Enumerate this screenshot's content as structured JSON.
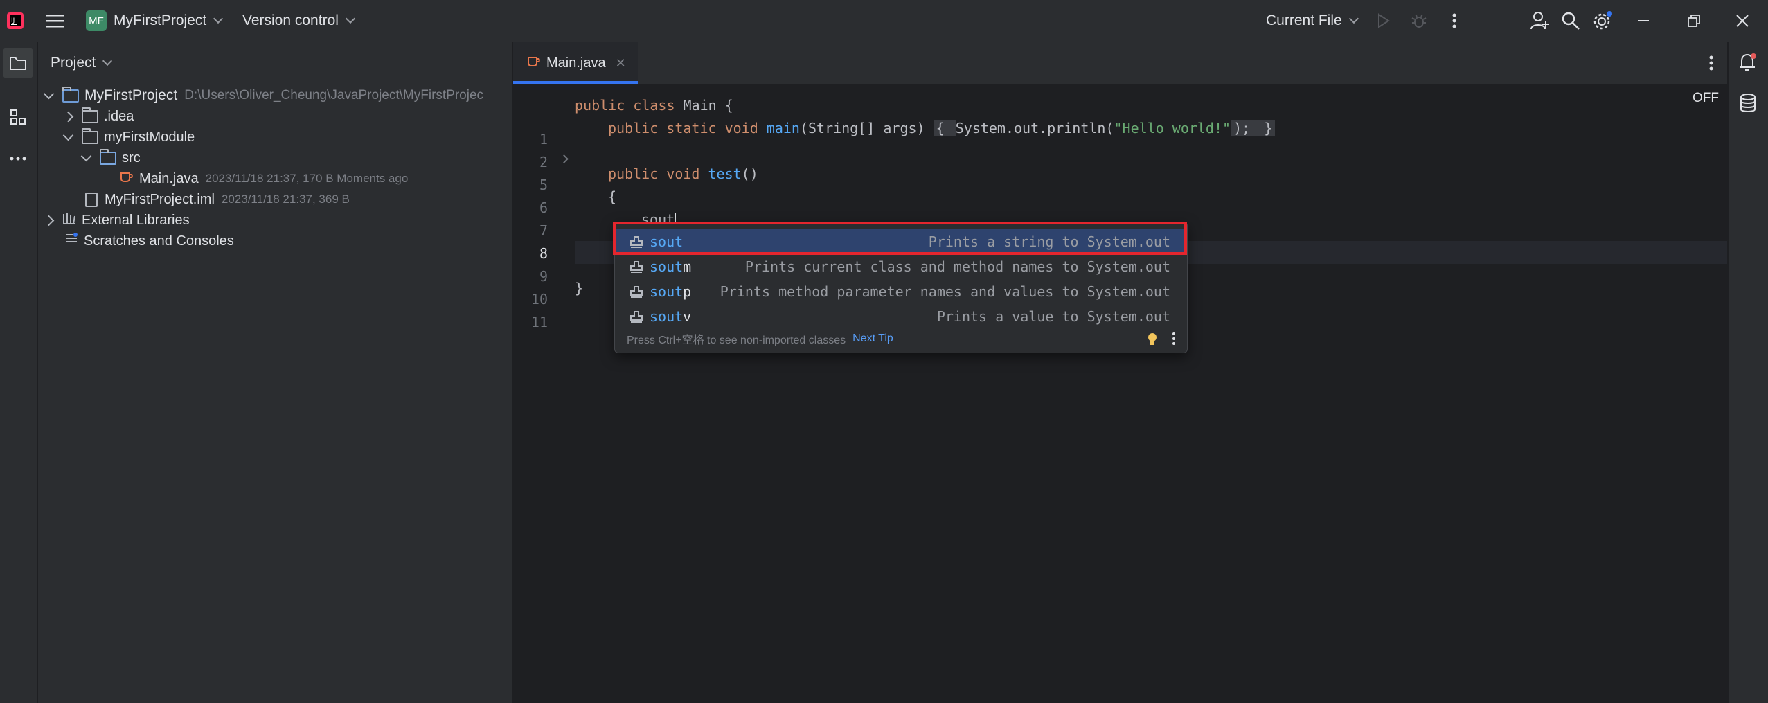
{
  "titlebar": {
    "project_badge": "MF",
    "project_name": "MyFirstProject",
    "vcs": "Version control",
    "run_config": "Current File"
  },
  "project_panel": {
    "title": "Project",
    "tree": [
      {
        "label": "MyFirstProject",
        "meta": "D:\\Users\\Oliver_Cheung\\JavaProject\\MyFirstProjec"
      },
      {
        "label": ".idea",
        "meta": ""
      },
      {
        "label": "myFirstModule",
        "meta": ""
      },
      {
        "label": "src",
        "meta": ""
      },
      {
        "label": "Main.java",
        "meta": "2023/11/18 21:37, 170 B Moments ago"
      },
      {
        "label": "MyFirstProject.iml",
        "meta": "2023/11/18 21:37, 369 B"
      },
      {
        "label": "External Libraries",
        "meta": ""
      },
      {
        "label": "Scratches and Consoles",
        "meta": ""
      }
    ]
  },
  "editor": {
    "tab_label": "Main.java",
    "inspection_status": "OFF",
    "line_numbers": [
      "1",
      "2",
      "5",
      "6",
      "7",
      "8",
      "9",
      "10",
      "11"
    ],
    "code": {
      "l1_kw": "public class ",
      "l1_name": "Main {",
      "l2_kw": "public static void ",
      "l2_fn": "main",
      "l2_args": "(String[] args) ",
      "l2_fold_open": "{ ",
      "l2_body": "System.out.println(",
      "l2_str": "\"Hello world!\"",
      "l2_end": ");",
      "l2_fold_close": " }",
      "l6_kw": "public void ",
      "l6_fn": "test",
      "l6_paren": "()",
      "l7": "{",
      "l8": "sout",
      "l11": "}"
    }
  },
  "completion": {
    "items": [
      {
        "match": "sout",
        "rest": "",
        "desc": "Prints a string to System.out"
      },
      {
        "match": "sout",
        "rest": "m",
        "desc": "Prints current class and method names to System.out"
      },
      {
        "match": "sout",
        "rest": "p",
        "desc": "Prints method parameter names and values to System.out"
      },
      {
        "match": "sout",
        "rest": "v",
        "desc": "Prints a value to System.out"
      }
    ],
    "footer_text": "Press Ctrl+空格 to see non-imported classes",
    "footer_link": "Next Tip"
  },
  "colors": {
    "accent": "#3574f0",
    "highlight_box": "#e4262e",
    "keyword": "#cf8e6d",
    "string": "#6aab73",
    "function": "#56a8f5"
  }
}
